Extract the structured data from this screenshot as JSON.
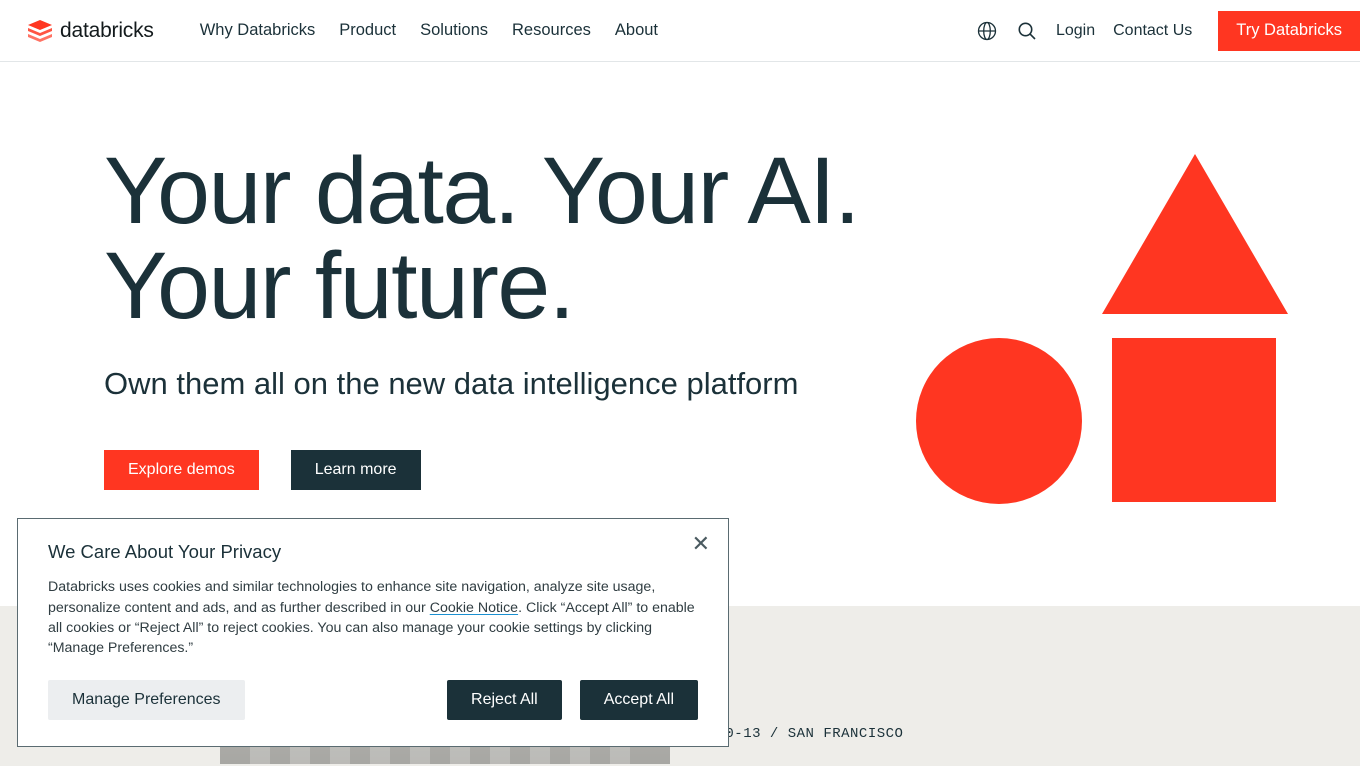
{
  "brand": {
    "name": "databricks",
    "accent": "#ff3621"
  },
  "nav": {
    "items": [
      {
        "label": "Why Databricks"
      },
      {
        "label": "Product"
      },
      {
        "label": "Solutions"
      },
      {
        "label": "Resources"
      },
      {
        "label": "About"
      }
    ],
    "login": "Login",
    "contact": "Contact Us",
    "try": "Try Databricks"
  },
  "hero": {
    "title_line1": "Your data. Your AI.",
    "title_line2": "Your future.",
    "subtitle": "Own them all on the new data intelligence platform",
    "primary_btn": "Explore demos",
    "secondary_btn": "Learn more"
  },
  "banner": {
    "text": "JUNE 10-13 / SAN FRANCISCO"
  },
  "cookie": {
    "title": "We Care About Your Privacy",
    "body_pre": "Databricks uses cookies and similar technologies to enhance site navigation, analyze site usage, personalize content and ads, and as further described in our ",
    "link": "Cookie Notice",
    "body_post": ". Click “Accept All” to enable all cookies or “Reject All” to reject cookies. You can also manage your cookie settings by clicking “Manage Preferences.”",
    "manage": "Manage Preferences",
    "reject": "Reject All",
    "accept": "Accept All"
  }
}
